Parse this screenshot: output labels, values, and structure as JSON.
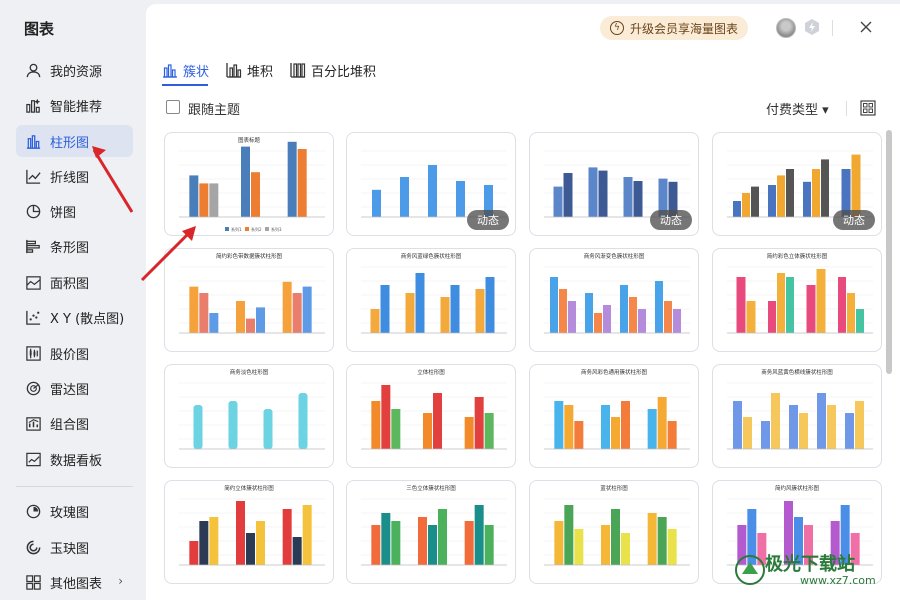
{
  "sidebar": {
    "title": "图表",
    "items": [
      {
        "label": "我的资源",
        "icon": "user-icon"
      },
      {
        "label": "智能推荐",
        "icon": "smart-recommend-icon"
      },
      {
        "label": "柱形图",
        "icon": "bar-chart-icon",
        "active": true
      },
      {
        "label": "折线图",
        "icon": "line-chart-icon"
      },
      {
        "label": "饼图",
        "icon": "pie-chart-icon"
      },
      {
        "label": "条形图",
        "icon": "horizontal-bar-icon"
      },
      {
        "label": "面积图",
        "icon": "area-chart-icon"
      },
      {
        "label": "X Y (散点图)",
        "icon": "scatter-icon"
      },
      {
        "label": "股价图",
        "icon": "stock-chart-icon"
      },
      {
        "label": "雷达图",
        "icon": "radar-chart-icon"
      },
      {
        "label": "组合图",
        "icon": "combo-chart-icon"
      },
      {
        "label": "数据看板",
        "icon": "dashboard-icon"
      },
      {
        "label": "玫瑰图",
        "icon": "rose-chart-icon"
      },
      {
        "label": "玉玦图",
        "icon": "ring-chart-icon"
      },
      {
        "label": "其他图表",
        "icon": "other-charts-icon"
      }
    ]
  },
  "header": {
    "upgrade_label": "升级会员享海量图表"
  },
  "tabs": [
    {
      "label": "簇状",
      "active": true
    },
    {
      "label": "堆积"
    },
    {
      "label": "百分比堆积"
    }
  ],
  "filters": {
    "follow_theme_label": "跟随主题",
    "follow_theme_checked": false,
    "paid_type_label": "付费类型 ▾"
  },
  "colors": {
    "accent": "#2d5fdc",
    "upgrade_bg": "#fbecd8",
    "annotation_arrow": "#d8262b"
  },
  "cards": [
    {
      "title": "图表标题",
      "badge": "",
      "legend": [
        "系列1",
        "系列2",
        "系列3"
      ]
    },
    {
      "title": "",
      "badge": "动态"
    },
    {
      "title": "",
      "badge": "动态"
    },
    {
      "title": "",
      "badge": "动态"
    },
    {
      "title": "简约彩色带数据簇状柱形图",
      "badge": ""
    },
    {
      "title": "商务风蓝绿色簇状柱形图",
      "badge": ""
    },
    {
      "title": "商务风渐变色簇状柱形图",
      "badge": ""
    },
    {
      "title": "简约彩色立体簇状柱形图",
      "badge": ""
    },
    {
      "title": "商务淡色柱形图",
      "badge": ""
    },
    {
      "title": "立体柱形图",
      "badge": ""
    },
    {
      "title": "商务风彩色通用簇状柱形图",
      "badge": ""
    },
    {
      "title": "商务风蓝黄色横线簇状柱形图",
      "badge": ""
    },
    {
      "title": "简约立体簇状柱形图",
      "badge": ""
    },
    {
      "title": "三色立体簇状柱形图",
      "badge": ""
    },
    {
      "title": "蓝状柱形图",
      "badge": ""
    },
    {
      "title": "简约风簇状柱形图",
      "badge": ""
    }
  ],
  "watermark": {
    "text": "极光下载站",
    "url": "www.xz7.com"
  }
}
